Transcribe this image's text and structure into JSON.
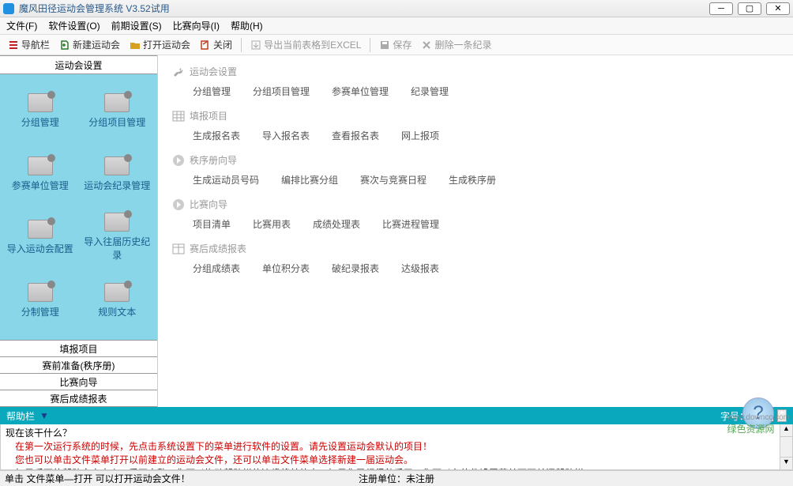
{
  "title": "魔风田径运动会管理系统 V3.52试用",
  "menu": [
    "文件(F)",
    "软件设置(O)",
    "前期设置(S)",
    "比赛向导(I)",
    "帮助(H)"
  ],
  "toolbar": [
    {
      "label": "导航栏",
      "icon": "nav",
      "color": "#c02020"
    },
    {
      "label": "新建运动会",
      "icon": "new",
      "color": "#2a7a2a"
    },
    {
      "label": "打开运动会",
      "icon": "open",
      "color": "#d8a020"
    },
    {
      "label": "关闭",
      "icon": "close",
      "color": "#c04020"
    },
    {
      "sep": true
    },
    {
      "label": "导出当前表格到EXCEL",
      "icon": "export",
      "color": "#808080",
      "disabled": true
    },
    {
      "sep": true
    },
    {
      "label": "保存",
      "icon": "save",
      "color": "#808080",
      "disabled": true
    },
    {
      "label": "删除一条纪录",
      "icon": "delete",
      "color": "#808080",
      "disabled": true
    }
  ],
  "sidebar": {
    "header": "运动会设置",
    "items": [
      {
        "label": "分组管理"
      },
      {
        "label": "分组项目管理"
      },
      {
        "label": "参赛单位管理"
      },
      {
        "label": "运动会纪录管理"
      },
      {
        "label": "导入运动会配置"
      },
      {
        "label": "导入往届历史纪录"
      },
      {
        "label": "分制管理"
      },
      {
        "label": "规则文本"
      }
    ],
    "bottom": [
      "填报项目",
      "赛前准备(秩序册)",
      "比赛向导",
      "赛后成绩报表"
    ]
  },
  "sections": [
    {
      "title": "运动会设置",
      "icon": "wrench",
      "links": [
        "分组管理",
        "分组项目管理",
        "参赛单位管理",
        "纪录管理"
      ]
    },
    {
      "title": "填报项目",
      "icon": "grid",
      "links": [
        "生成报名表",
        "导入报名表",
        "查看报名表",
        "网上报项"
      ]
    },
    {
      "title": "秩序册向导",
      "icon": "arrow",
      "links": [
        "生成运动员号码",
        "编排比赛分组",
        "赛次与竞赛日程",
        "生成秩序册"
      ]
    },
    {
      "title": "比赛向导",
      "icon": "arrow",
      "links": [
        "项目清单",
        "比赛用表",
        "成绩处理表",
        "比赛进程管理"
      ]
    },
    {
      "title": "赛后成绩报表",
      "icon": "table",
      "links": [
        "分组成绩表",
        "单位积分表",
        "破纪录报表",
        "达级报表"
      ]
    }
  ],
  "help": {
    "title": "帮助栏",
    "fontLabel": "字号：",
    "fontValue": "13",
    "lines": [
      {
        "text": "现在该干什么？",
        "red": false
      },
      {
        "text": "　在第一次运行系统的时候，先点击系统设置下的菜单进行软件的设置。请先设置运动会默认的项目！",
        "red": true
      },
      {
        "text": "　您也可以单击文件菜单打开以前建立的运动会文件，还可以单击文件菜单选择新建一届运动会。",
        "red": true
      },
      {
        "text": "　如果后面的帮助文字太少，看不完整，您可以拖动帮助栏的边缘将其放大。如果您已经很熟悉了，您可以在软件设置菜单下面关闭帮助栏。",
        "red": false
      }
    ]
  },
  "status": {
    "left": "单击 文件菜单—打开 可以打开运动会文件！",
    "mid": "注册单位：未注册"
  },
  "watermark": {
    "main": "绿色资源网",
    "sub": "www.downcc.com"
  }
}
